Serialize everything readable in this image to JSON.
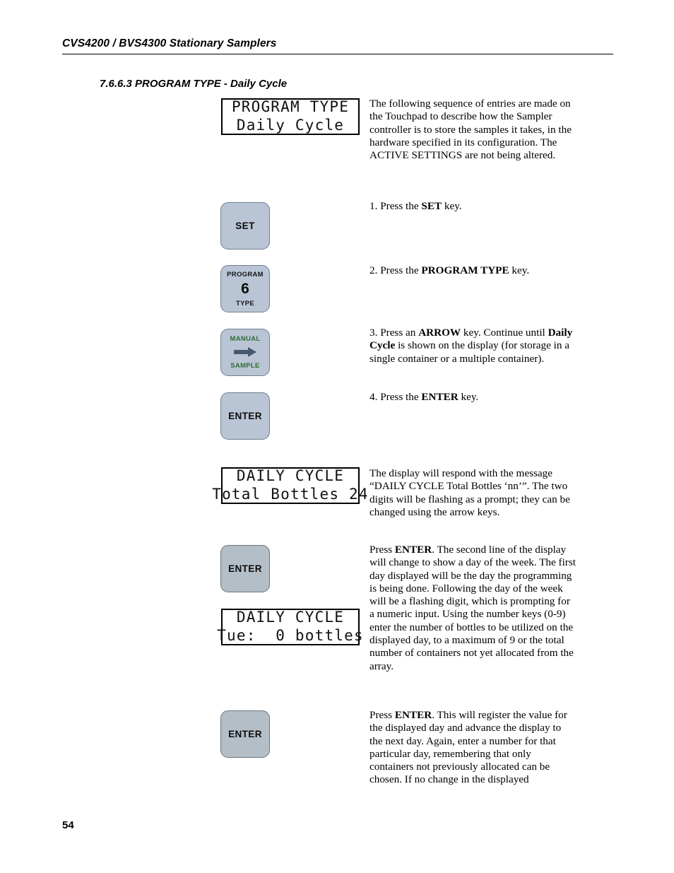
{
  "header": {
    "running_title": "CVS4200 / BVS4300 Stationary Samplers"
  },
  "section": {
    "number": "7.6.6.3",
    "title": "PROGRAM TYPE - Daily Cycle",
    "heading_full": "7.6.6.3  PROGRAM TYPE - Daily Cycle"
  },
  "displays": [
    {
      "name": "program-type-display",
      "line1": "PROGRAM TYPE",
      "line2": "Daily Cycle"
    },
    {
      "name": "daily-cycle-total-bottles-display",
      "line1": "DAILY CYCLE",
      "line2": "Total Bottles 24"
    },
    {
      "name": "daily-cycle-day-bottles-display",
      "line1": "DAILY CYCLE",
      "line2": "Tue:  0 bottles"
    }
  ],
  "keys": {
    "set": {
      "label": "SET"
    },
    "program_type": {
      "top_label": "PROGRAM",
      "digit": "6",
      "bottom_label": "TYPE"
    },
    "manual_sample": {
      "top_label": "MANUAL",
      "icon": "right-arrow-icon",
      "bottom_label": "SAMPLE"
    },
    "enter": {
      "label": "ENTER"
    }
  },
  "paragraphs": {
    "intro": "The following sequence of entries are made on the Touchpad to describe how the Sampler controller is to store the samples it takes, in the hardware specified in its configuration. The ACTIVE SETTINGS are not being altered.",
    "step1_pre": "1. Press the ",
    "step1_bold": "SET",
    "step1_post": " key.",
    "step2_pre": "2. Press the ",
    "step2_bold": "PROGRAM TYPE",
    "step2_post": " key.",
    "step3_pre": "3. Press an ",
    "step3_bold1": "ARROW",
    "step3_mid": " key. Continue until ",
    "step3_bold2": "Daily Cycle",
    "step3_post": " is shown on the display (for storage in a single container or a multiple container).",
    "step4_pre": "4. Press the ",
    "step4_bold": "ENTER",
    "step4_post": " key.",
    "response": "The display will respond with the message “DAILY CYCLE Total Bottles ‘nn’”. The two digits will be flashing as a prompt; they can be changed using the arrow keys.",
    "enter2_pre": "Press ",
    "enter2_bold": "ENTER",
    "enter2_post": ". The second line of the display will change to show a day of the week.  The first day displayed will be the day the programming is being done. Following the day of the week will be a flashing digit, which is prompting for a numeric input.  Using the number keys (0-9) enter the number of bottles to be utilized on the displayed day, to a maximum of 9 or the total number of containers not yet allocated from the array.",
    "enter3_pre": "Press ",
    "enter3_bold": "ENTER",
    "enter3_post": ". This will register the value for the displayed day and advance the display to the next day. Again, enter a number for that particular day, remembering that only containers not previously allocated can be chosen. If no change in the displayed"
  },
  "footer": {
    "page_number": "54"
  },
  "colors": {
    "key_blue": "#b9c4d4",
    "key_gray": "#b4bec6",
    "key_border": "#6f7f92",
    "green_label": "#2f6b34",
    "arrow": "#46586e"
  }
}
